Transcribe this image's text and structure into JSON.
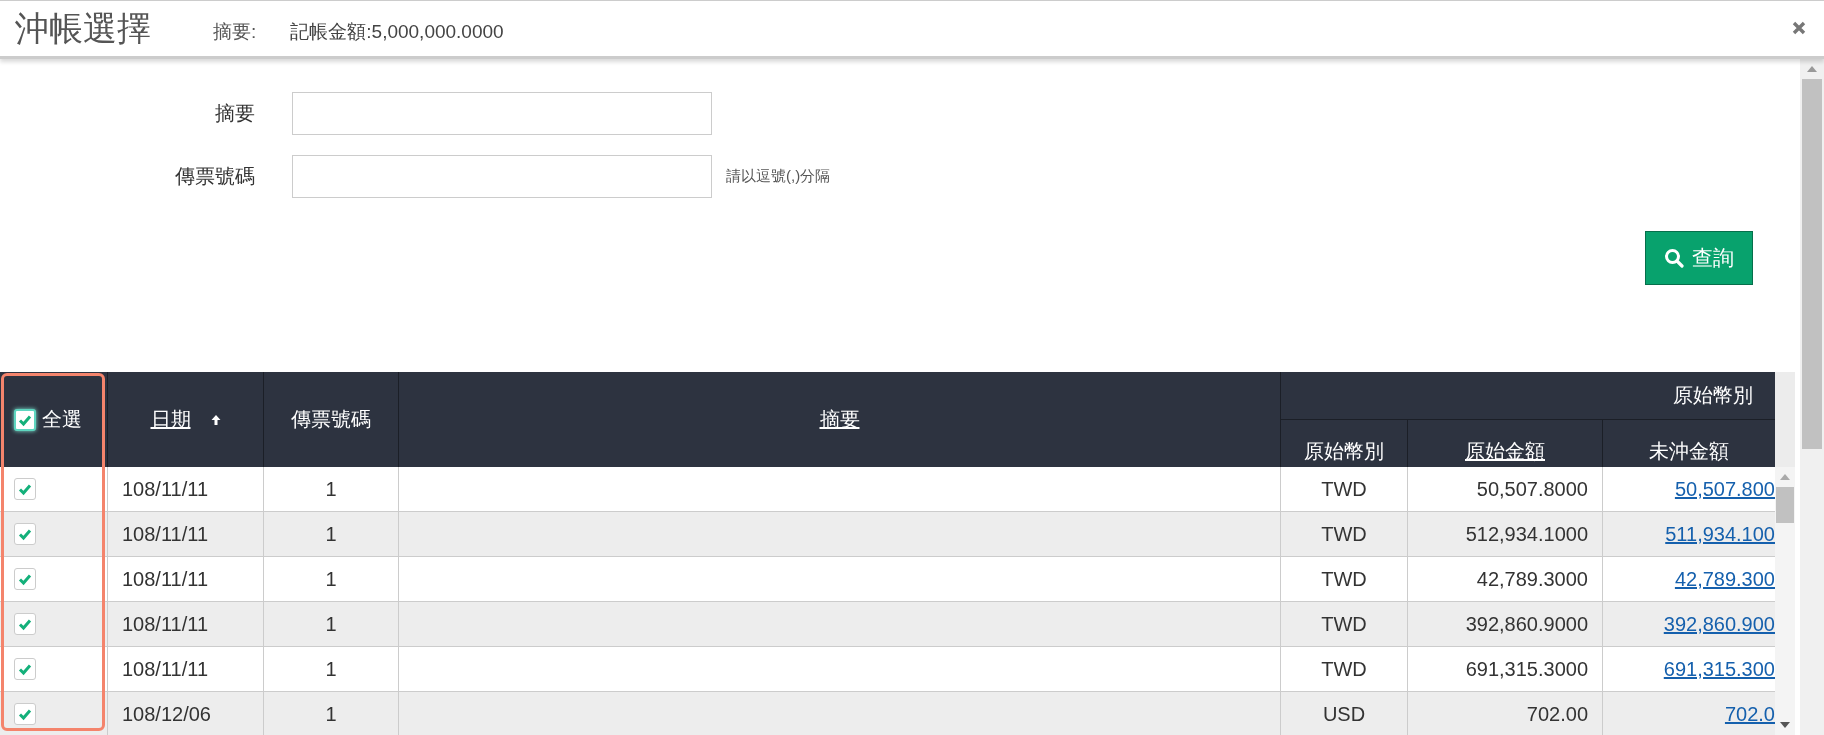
{
  "dialog": {
    "title": "沖帳選擇",
    "summary_label": "摘要:",
    "amount_label": "記帳金額:5,000,000.0000"
  },
  "filters": [
    {
      "label": "摘要"
    },
    {
      "label": "傳票號碼",
      "hint": "請以逗號(,)分隔"
    }
  ],
  "search_button": "查詢",
  "table": {
    "select_all": {
      "label": "全選",
      "checked": true
    },
    "select_column_highlighted": true,
    "columns": [
      {
        "label": "日期",
        "kind": "link",
        "sorted_ascending": true
      },
      {
        "label": "傳票號碼",
        "kind": "plain"
      },
      {
        "label": "摘要",
        "kind": "link"
      }
    ],
    "group": {
      "label": "原始幣別",
      "columns": [
        {
          "label": "原始幣別",
          "kind": "plain"
        },
        {
          "label": "原始金額",
          "kind": "link"
        },
        {
          "label": "未沖金額",
          "kind": "plain"
        }
      ]
    },
    "rows": [
      {
        "checked": true,
        "date": "108/11/11",
        "voucher": "1",
        "currency": "TWD",
        "amount": "50,507.8000",
        "unpaid": "50,507.800"
      },
      {
        "checked": true,
        "date": "108/11/11",
        "voucher": "1",
        "currency": "TWD",
        "amount": "512,934.1000",
        "unpaid": "511,934.100"
      },
      {
        "checked": true,
        "date": "108/11/11",
        "voucher": "1",
        "currency": "TWD",
        "amount": "42,789.3000",
        "unpaid": "42,789.300"
      },
      {
        "checked": true,
        "date": "108/11/11",
        "voucher": "1",
        "currency": "TWD",
        "amount": "392,860.9000",
        "unpaid": "392,860.900"
      },
      {
        "checked": true,
        "date": "108/11/11",
        "voucher": "1",
        "currency": "TWD",
        "amount": "691,315.3000",
        "unpaid": "691,315.300"
      },
      {
        "checked": true,
        "date": "108/12/06",
        "voucher": "1",
        "currency": "USD",
        "amount": "702.00",
        "unpaid": "702.0"
      }
    ]
  }
}
